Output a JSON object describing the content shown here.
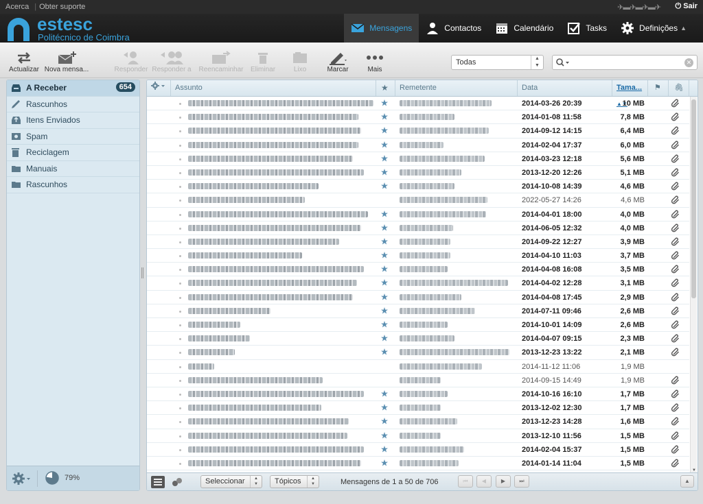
{
  "toplinks": {
    "about": "Acerca",
    "support": "Obter suporte",
    "logout": "Sair"
  },
  "brand": {
    "name": "estesc",
    "subtitle": "Politécnico de Coimbra",
    "color": "#3aa3dc"
  },
  "nav": [
    {
      "label": "Mensagens",
      "icon": "mail-icon",
      "active": true
    },
    {
      "label": "Contactos",
      "icon": "person-icon"
    },
    {
      "label": "Calendário",
      "icon": "calendar-icon"
    },
    {
      "label": "Tasks",
      "icon": "checkbox-icon"
    },
    {
      "label": "Definições",
      "icon": "gear-icon"
    }
  ],
  "toolbar": {
    "refresh": "Actualizar",
    "compose": "Nova mensa...",
    "reply": "Responder",
    "reply_all": "Responder a",
    "forward": "Reencaminhar",
    "delete": "Eliminar",
    "junk": "Lixo",
    "mark": "Marcar",
    "more": "Mais"
  },
  "filter": {
    "value": "Todas"
  },
  "search": {
    "value": ""
  },
  "folders": [
    {
      "label": "A Receber",
      "icon": "inbox-icon",
      "badge": "654",
      "active": true
    },
    {
      "label": "Rascunhos",
      "icon": "pencil-icon"
    },
    {
      "label": "Itens Enviados",
      "icon": "sent-icon"
    },
    {
      "label": "Spam",
      "icon": "junk-icon"
    },
    {
      "label": "Reciclagem",
      "icon": "trash-icon"
    },
    {
      "label": "Manuais",
      "icon": "folder-icon"
    },
    {
      "label": "Rascunhos",
      "icon": "folder-icon"
    }
  ],
  "quota": "79%",
  "columns": {
    "subject": "Assunto",
    "sender": "Remetente",
    "date": "Data",
    "size": "Tama..."
  },
  "messages": [
    {
      "date": "2014-03-26 20:39",
      "size": "10 MB",
      "unread": true,
      "flag": true,
      "attach": true
    },
    {
      "date": "2014-01-08 11:58",
      "size": "7,8 MB",
      "unread": true,
      "flag": true,
      "attach": true
    },
    {
      "date": "2014-09-12 14:15",
      "size": "6,4 MB",
      "unread": true,
      "flag": true,
      "attach": true
    },
    {
      "date": "2014-02-04 17:37",
      "size": "6,0 MB",
      "unread": true,
      "flag": true,
      "attach": true
    },
    {
      "date": "2014-03-23 12:18",
      "size": "5,6 MB",
      "unread": true,
      "flag": true,
      "attach": true
    },
    {
      "date": "2013-12-20 12:26",
      "size": "5,1 MB",
      "unread": true,
      "flag": true,
      "attach": true
    },
    {
      "date": "2014-10-08 14:39",
      "size": "4,6 MB",
      "unread": true,
      "flag": true,
      "attach": true
    },
    {
      "date": "2022-05-27 14:26",
      "size": "4,6 MB",
      "unread": false,
      "flag": false,
      "attach": true
    },
    {
      "date": "2014-04-01 18:00",
      "size": "4,0 MB",
      "unread": true,
      "flag": true,
      "attach": true
    },
    {
      "date": "2014-06-05 12:32",
      "size": "4,0 MB",
      "unread": true,
      "flag": true,
      "attach": true
    },
    {
      "date": "2014-09-22 12:27",
      "size": "3,9 MB",
      "unread": true,
      "flag": true,
      "attach": true
    },
    {
      "date": "2014-04-10 11:03",
      "size": "3,7 MB",
      "unread": true,
      "flag": true,
      "attach": true
    },
    {
      "date": "2014-04-08 16:08",
      "size": "3,5 MB",
      "unread": true,
      "flag": true,
      "attach": true
    },
    {
      "date": "2014-04-02 12:28",
      "size": "3,1 MB",
      "unread": true,
      "flag": true,
      "attach": true
    },
    {
      "date": "2014-04-08 17:45",
      "size": "2,9 MB",
      "unread": true,
      "flag": true,
      "attach": true
    },
    {
      "date": "2014-07-11 09:46",
      "size": "2,6 MB",
      "unread": true,
      "flag": true,
      "attach": true
    },
    {
      "date": "2014-10-01 14:09",
      "size": "2,6 MB",
      "unread": true,
      "flag": true,
      "attach": true
    },
    {
      "date": "2014-04-07 09:15",
      "size": "2,3 MB",
      "unread": true,
      "flag": true,
      "attach": true
    },
    {
      "date": "2013-12-23 13:22",
      "size": "2,1 MB",
      "unread": true,
      "flag": true,
      "attach": true
    },
    {
      "date": "2014-11-12 11:06",
      "size": "1,9 MB",
      "unread": false,
      "flag": false,
      "attach": false
    },
    {
      "date": "2014-09-15 14:49",
      "size": "1,9 MB",
      "unread": false,
      "flag": false,
      "attach": true
    },
    {
      "date": "2014-10-16 16:10",
      "size": "1,7 MB",
      "unread": true,
      "flag": true,
      "attach": true
    },
    {
      "date": "2013-12-02 12:30",
      "size": "1,7 MB",
      "unread": true,
      "flag": true,
      "attach": true
    },
    {
      "date": "2013-12-23 14:28",
      "size": "1,6 MB",
      "unread": true,
      "flag": true,
      "attach": true
    },
    {
      "date": "2013-12-10 11:56",
      "size": "1,5 MB",
      "unread": true,
      "flag": true,
      "attach": true
    },
    {
      "date": "2014-02-04 15:37",
      "size": "1,5 MB",
      "unread": true,
      "flag": true,
      "attach": true
    },
    {
      "date": "2014-01-14 11:04",
      "size": "1,5 MB",
      "unread": true,
      "flag": true,
      "attach": true
    }
  ],
  "footer": {
    "select": "Seleccionar",
    "threads": "Tópicos",
    "count": "Mensagens de 1 a 50 de 706"
  }
}
